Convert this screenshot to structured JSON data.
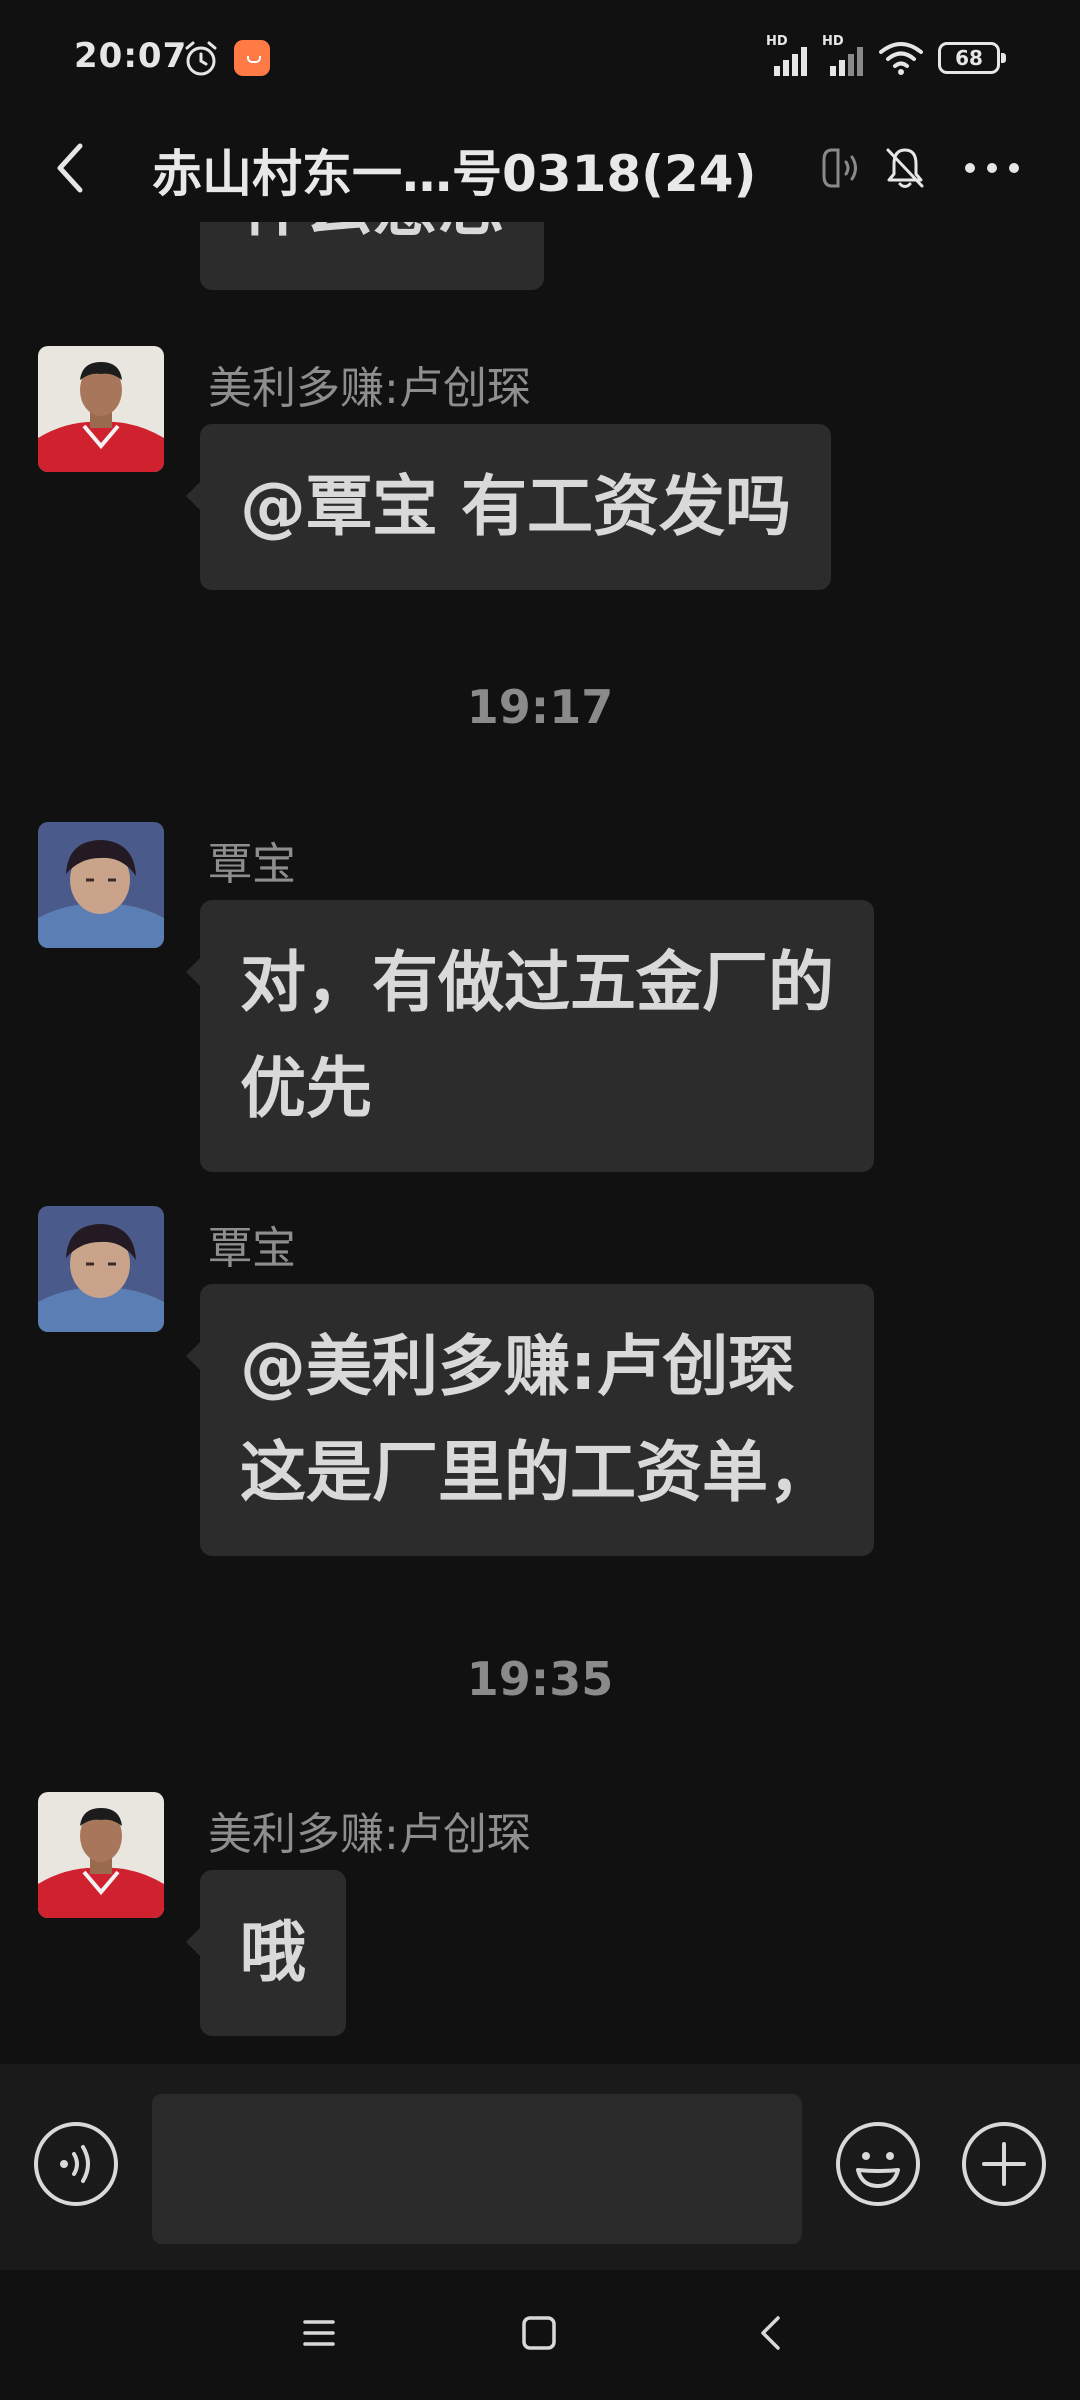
{
  "status_bar": {
    "time": "20:07",
    "signal1_label": "HD",
    "signal2_label": "HD",
    "battery_level": "68",
    "icons": [
      "alarm-icon",
      "app-notification-icon",
      "signal-icon",
      "signal-icon",
      "wifi-icon",
      "battery-icon"
    ]
  },
  "header": {
    "title": "赤山村东一…号0318(24)",
    "icons": [
      "back-icon",
      "earpiece-icon",
      "mute-bell-icon",
      "more-icon"
    ]
  },
  "messages": {
    "partial_text": "什么意思",
    "msg1": {
      "sender": "美利多赚:卢创琛",
      "lines": [
        "@覃宝  有工资发吗"
      ]
    },
    "time1": "19:17",
    "msg2": {
      "sender": "覃宝",
      "lines": [
        "对，有做过五金厂的",
        "优先"
      ]
    },
    "msg3": {
      "sender": "覃宝",
      "lines": [
        "@美利多赚:卢创琛",
        "这是厂里的工资单，"
      ]
    },
    "time2": "19:35",
    "msg4": {
      "sender": "美利多赚:卢创琛",
      "lines": [
        "哦"
      ]
    }
  },
  "input_bar": {
    "placeholder": "",
    "icons": [
      "voice-icon",
      "emoji-icon",
      "add-icon"
    ]
  },
  "nav_bar": {
    "icons": [
      "menu-icon",
      "home-icon",
      "back-nav-icon"
    ]
  },
  "colors": {
    "background": "#111111",
    "bubble": "#2c2c2c",
    "input_bar": "#1a1a1a",
    "text": "#d9d9d9",
    "sender_text": "#8e8e8e"
  }
}
